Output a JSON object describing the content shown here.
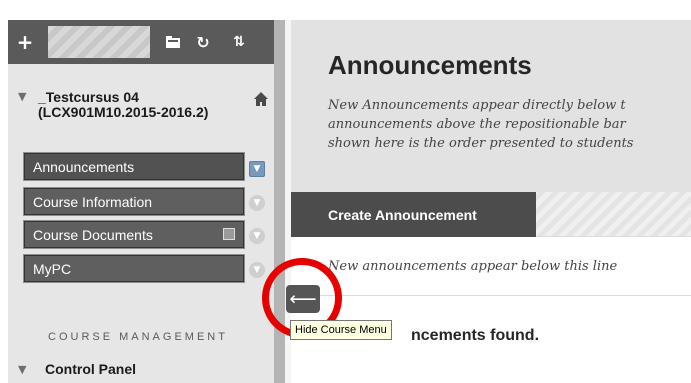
{
  "sidebar": {
    "toolbar": {
      "add_icon": "plus",
      "add_label": "+",
      "folder_icon": "folder-icon",
      "refresh_icon": "refresh-icon",
      "refresh_label": "↻",
      "sort_icon": "sort-icon",
      "sort_label": "⇅"
    },
    "course": {
      "title": "_Testcursus 04 (LCX901M10.2015-2016.2)",
      "expanded_icon": "caret-down-icon",
      "home_icon": "home-icon"
    },
    "items": [
      {
        "label": "Announcements",
        "active": true
      },
      {
        "label": "Course Information"
      },
      {
        "label": "Course Documents"
      },
      {
        "label": "MyPC"
      }
    ],
    "section_label": "COURSE MANAGEMENT",
    "control_panel_label": "Control Panel"
  },
  "main": {
    "title": "Announcements",
    "description_lines": [
      "New Announcements appear directly below t",
      "announcements above the repositionable bar",
      "shown here is the order presented to students"
    ],
    "create_button_label": "Create Announcement",
    "bar_note": "New announcements appear below this line",
    "empty_message": "ncements found."
  },
  "collapse_control": {
    "arrow_label": "⟵",
    "tooltip": "Hide Course Menu"
  },
  "colors": {
    "toolbar": "#5a5a5a",
    "menu_item": "#5f5f5f",
    "selected_chevron": "#7799bb",
    "header_bg": "#e2e2e2",
    "create_button": "#4c4c4c",
    "highlight_ring": "#e60000"
  }
}
